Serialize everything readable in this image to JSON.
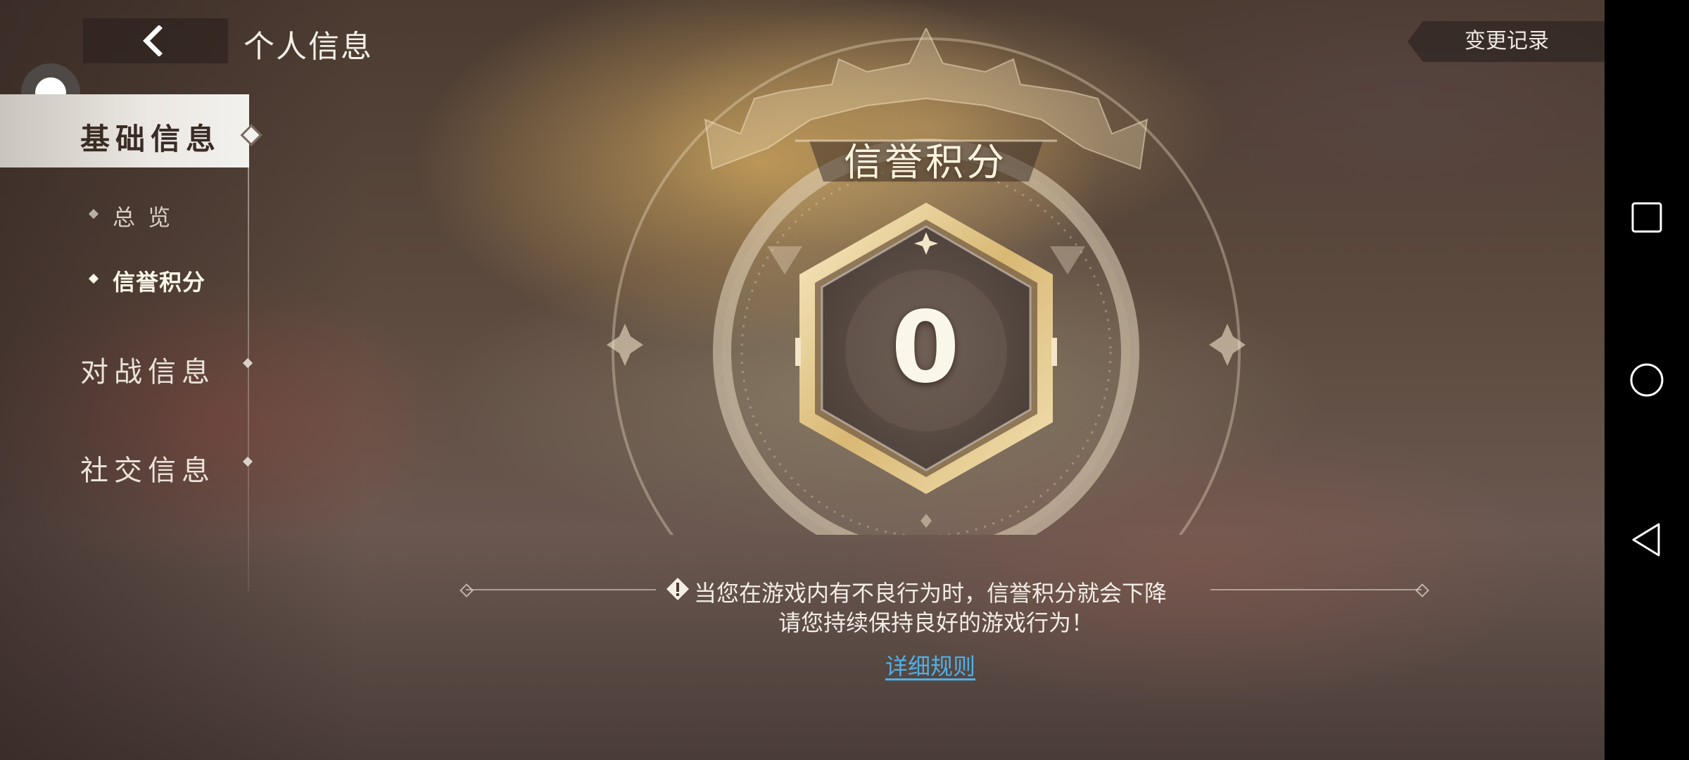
{
  "header": {
    "title": "个人信息",
    "change_log_label": "变更记录"
  },
  "sidebar": {
    "items": [
      {
        "label": "基础信息",
        "active": true
      },
      {
        "label": "总 览",
        "sub": true
      },
      {
        "label": "信誉积分",
        "sub": true,
        "current": true
      },
      {
        "label": "对战信息"
      },
      {
        "label": "社交信息"
      }
    ]
  },
  "credit": {
    "title": "信誉积分",
    "score": "0"
  },
  "notice": {
    "line1": "当您在游戏内有不良行为时，信誉积分就会下降",
    "line2": "请您持续保持良好的游戏行为！",
    "rules_link": "详细规则"
  },
  "colors": {
    "accent_gold": "#e8d3a0",
    "link_blue": "#4fb0e6",
    "active_tab_bg": "#f3f1ee"
  },
  "icons": [
    "back-arrow-icon",
    "warning-icon",
    "square-icon",
    "circle-icon",
    "triangle-back-icon"
  ]
}
